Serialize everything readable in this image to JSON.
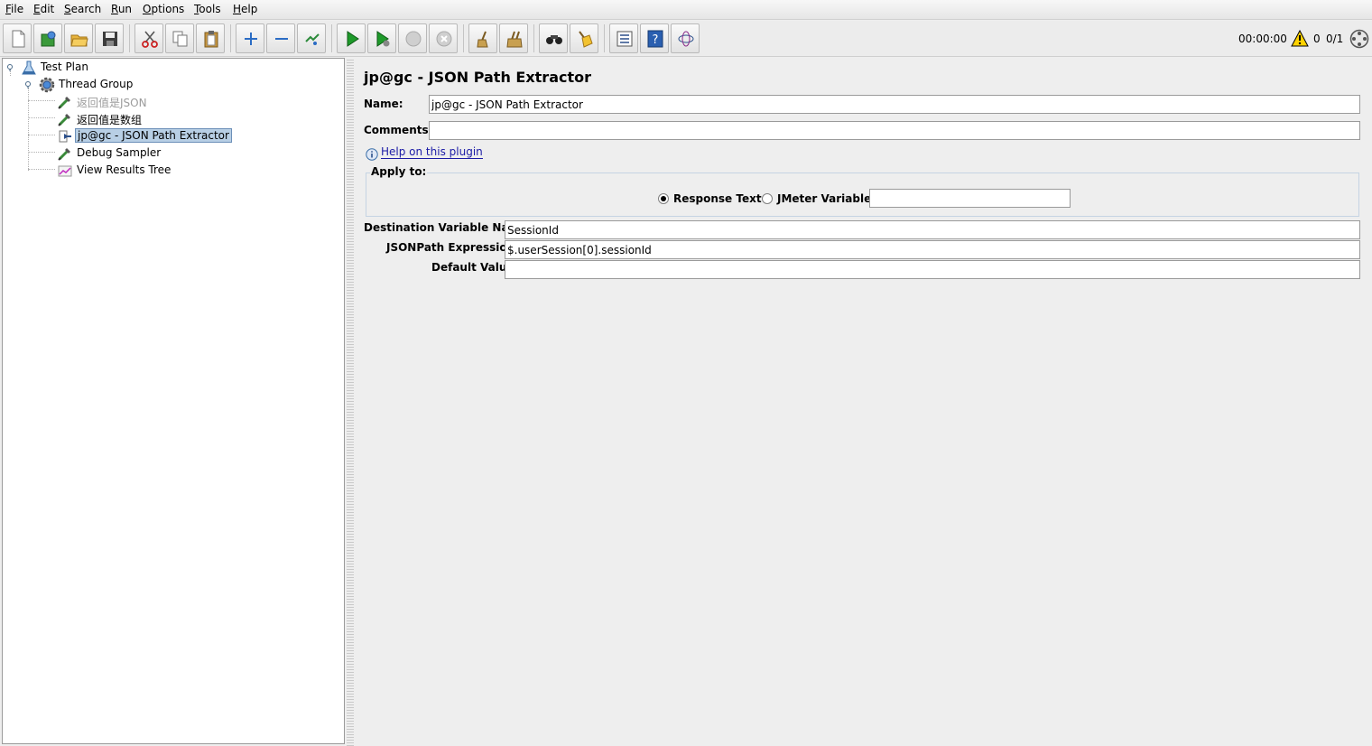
{
  "menu": [
    "File",
    "Edit",
    "Search",
    "Run",
    "Options",
    "Tools",
    "Help"
  ],
  "toolbar": {
    "icons": [
      "new-icon",
      "templates-icon",
      "open-icon",
      "save-icon",
      "cut-icon",
      "copy-icon",
      "paste-icon",
      "expand-icon",
      "collapse-icon",
      "toggle-icon",
      "start-icon",
      "start-no-pause-icon",
      "stop-icon",
      "shutdown-icon",
      "clear-icon",
      "clear-all-icon",
      "search-icon",
      "reset-search-icon",
      "function-helper-icon",
      "help-icon",
      "remote-icon"
    ],
    "timer": "00:00:00",
    "warning_count": "0",
    "thread_count": "0/1"
  },
  "tree": {
    "nodes": [
      {
        "label": "Test Plan",
        "icon": "test-plan-icon",
        "disabled": false,
        "selected": false
      },
      {
        "label": "Thread Group",
        "icon": "thread-group-icon",
        "disabled": false,
        "selected": false
      },
      {
        "label": "返回值是JSON",
        "icon": "sampler-icon",
        "disabled": true,
        "selected": false
      },
      {
        "label": "返回值是数组",
        "icon": "sampler-icon",
        "disabled": false,
        "selected": false
      },
      {
        "label": "jp@gc - JSON Path Extractor",
        "icon": "post-processor-icon",
        "disabled": false,
        "selected": true
      },
      {
        "label": "Debug Sampler",
        "icon": "sampler-icon",
        "disabled": false,
        "selected": false
      },
      {
        "label": "View Results Tree",
        "icon": "listener-icon",
        "disabled": false,
        "selected": false
      }
    ]
  },
  "editor": {
    "title": "jp@gc - JSON Path Extractor",
    "name_label": "Name:",
    "name_value": "jp@gc - JSON Path Extractor",
    "comments_label": "Comments:",
    "comments_value": "",
    "help_link": "Help on this plugin",
    "apply_to_label": "Apply to:",
    "response_text_label": "Response Text",
    "jmeter_variable_label": "JMeter Variable:",
    "jmeter_variable_value": "",
    "dest_var_label": "Destination Variable Name:",
    "dest_var_value": "SessionId",
    "jsonpath_label": "JSONPath Expression:",
    "jsonpath_value": "$.userSession[0].sessionId",
    "default_label": "Default Value:",
    "default_value": ""
  }
}
